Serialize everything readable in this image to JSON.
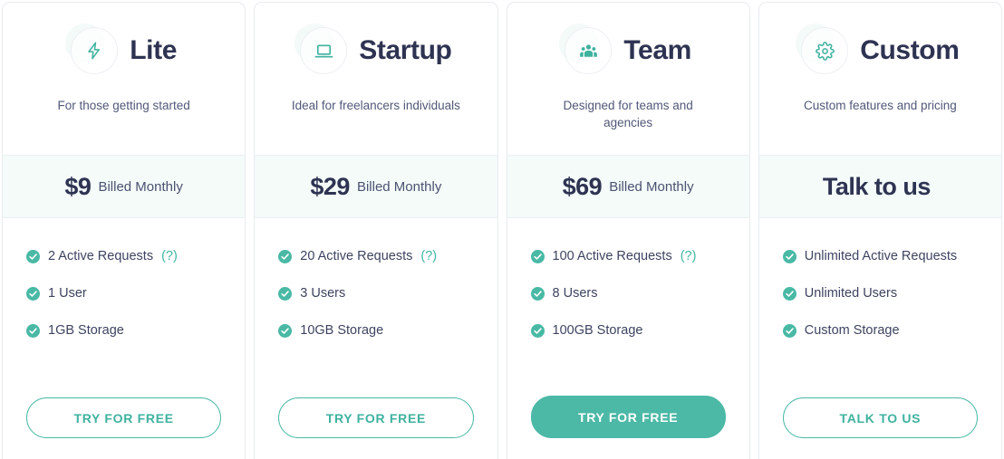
{
  "accent_color": "#4ab9a6",
  "heading_color": "#2e3352",
  "price_band_bg": "#f4fbf9",
  "plans": [
    {
      "icon": "lightning-bolt-icon",
      "name": "Lite",
      "description": "For those getting started",
      "price": "$9",
      "period": "Billed Monthly",
      "features": [
        {
          "label": "2 Active Requests",
          "help": "(?)"
        },
        {
          "label": "1 User",
          "help": ""
        },
        {
          "label": "1GB Storage",
          "help": ""
        }
      ],
      "cta_label": "TRY FOR FREE",
      "cta_style": "outline"
    },
    {
      "icon": "laptop-icon",
      "name": "Startup",
      "description": "Ideal for freelancers individuals",
      "price": "$29",
      "period": "Billed Monthly",
      "features": [
        {
          "label": "20 Active Requests",
          "help": "(?)"
        },
        {
          "label": "3 Users",
          "help": ""
        },
        {
          "label": "10GB Storage",
          "help": ""
        }
      ],
      "cta_label": "TRY FOR FREE",
      "cta_style": "outline"
    },
    {
      "icon": "people-group-icon",
      "name": "Team",
      "description": "Designed for teams and agencies",
      "price": "$69",
      "period": "Billed Monthly",
      "features": [
        {
          "label": "100 Active Requests",
          "help": "(?)"
        },
        {
          "label": "8 Users",
          "help": ""
        },
        {
          "label": "100GB Storage",
          "help": ""
        }
      ],
      "cta_label": "TRY FOR FREE",
      "cta_style": "filled"
    },
    {
      "icon": "gear-icon",
      "name": "Custom",
      "description": "Custom features and pricing",
      "price": "Talk to us",
      "period": "",
      "features": [
        {
          "label": "Unlimited Active Requests",
          "help": ""
        },
        {
          "label": "Unlimited Users",
          "help": ""
        },
        {
          "label": "Custom Storage",
          "help": ""
        }
      ],
      "cta_label": "TALK TO US",
      "cta_style": "outline"
    }
  ]
}
